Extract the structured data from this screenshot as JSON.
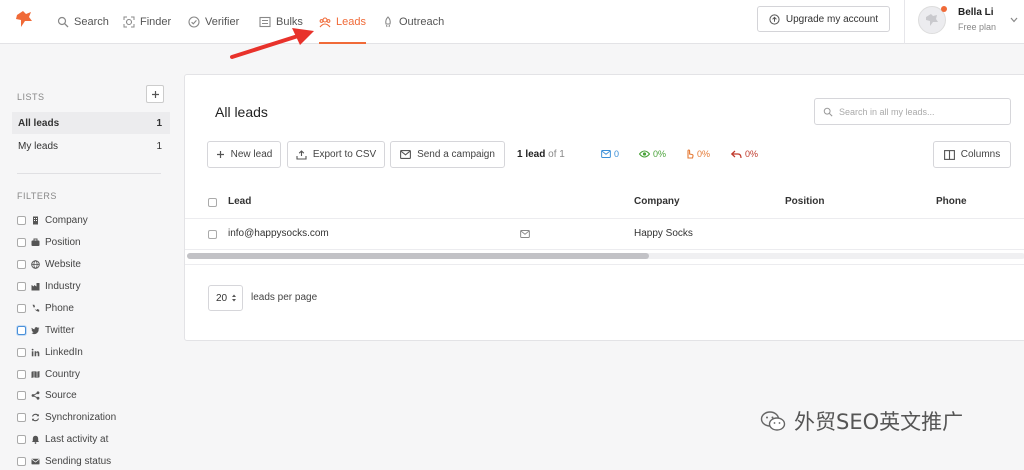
{
  "nav": {
    "items": [
      {
        "label": "Search",
        "icon": "search-icon"
      },
      {
        "label": "Finder",
        "icon": "finder-icon"
      },
      {
        "label": "Verifier",
        "icon": "check-circle-icon"
      },
      {
        "label": "Bulks",
        "icon": "list-icon"
      },
      {
        "label": "Leads",
        "icon": "leads-icon",
        "active": true
      },
      {
        "label": "Outreach",
        "icon": "rocket-icon"
      }
    ],
    "upgrade_label": "Upgrade my account",
    "user": {
      "name": "Bella Li",
      "plan": "Free plan"
    }
  },
  "sidebar": {
    "lists_heading": "LISTS",
    "lists": [
      {
        "label": "All leads",
        "count": "1",
        "active": true
      },
      {
        "label": "My leads",
        "count": "1"
      }
    ],
    "filters_heading": "FILTERS",
    "filters": [
      {
        "label": "Company",
        "icon": "building-icon"
      },
      {
        "label": "Position",
        "icon": "briefcase-icon"
      },
      {
        "label": "Website",
        "icon": "globe-icon"
      },
      {
        "label": "Industry",
        "icon": "industry-icon"
      },
      {
        "label": "Phone",
        "icon": "phone-icon"
      },
      {
        "label": "Twitter",
        "icon": "twitter-icon"
      },
      {
        "label": "LinkedIn",
        "icon": "linkedin-icon"
      },
      {
        "label": "Country",
        "icon": "map-icon"
      },
      {
        "label": "Source",
        "icon": "share-icon"
      },
      {
        "label": "Synchronization",
        "icon": "sync-icon"
      },
      {
        "label": "Last activity at",
        "icon": "bell-icon"
      },
      {
        "label": "Sending status",
        "icon": "envelope-icon"
      }
    ]
  },
  "main": {
    "title": "All leads",
    "search_placeholder": "Search in all my leads...",
    "toolbar": {
      "new_lead": "New lead",
      "export_csv": "Export to CSV",
      "send_campaign": "Send a campaign",
      "columns": "Columns"
    },
    "count": {
      "bold": "1 lead",
      "rest": " of 1"
    },
    "stats": [
      {
        "value": "0",
        "icon": "envelope-icon",
        "color": "#3a8fd8"
      },
      {
        "value": "0%",
        "icon": "eye-icon",
        "color": "#4aa33a"
      },
      {
        "value": "0%",
        "icon": "click-icon",
        "color": "#e57a35"
      },
      {
        "value": "0%",
        "icon": "reply-icon",
        "color": "#c0392b"
      }
    ],
    "table": {
      "headers": [
        "Lead",
        "Company",
        "Position",
        "Phone"
      ],
      "rows": [
        {
          "lead": "info@happysocks.com",
          "company": "Happy Socks",
          "position": "",
          "phone": ""
        }
      ]
    },
    "per_page": {
      "value": "20",
      "label": "leads per page"
    }
  },
  "watermark": {
    "text": "外贸SEO英文推广"
  },
  "colors": {
    "accent": "#f06a38",
    "annotation_arrow": "#e8322b"
  }
}
